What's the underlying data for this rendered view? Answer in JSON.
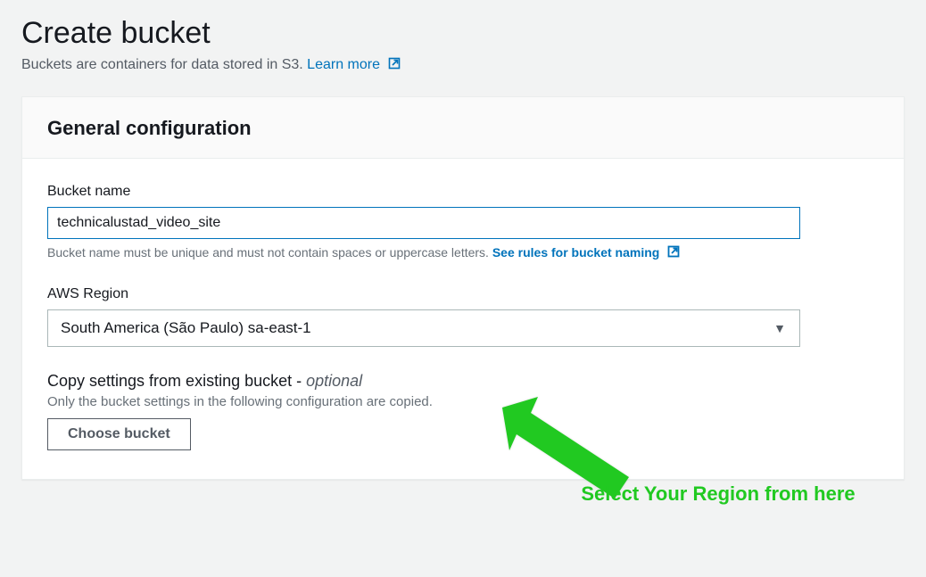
{
  "header": {
    "title": "Create bucket",
    "subtitle": "Buckets are containers for data stored in S3. ",
    "learn_more": "Learn more"
  },
  "panel": {
    "title": "General configuration"
  },
  "bucket_name": {
    "label": "Bucket name",
    "value": "technicalustad_video_site",
    "hint_text": "Bucket name must be unique and must not contain spaces or uppercase letters. ",
    "hint_link": "See rules for bucket naming"
  },
  "region": {
    "label": "AWS Region",
    "selected": "South America (São Paulo) sa-east-1"
  },
  "copy": {
    "heading_prefix": "Copy settings from existing bucket - ",
    "heading_optional": "optional",
    "sub": "Only the bucket settings in the following configuration are copied.",
    "button": "Choose bucket"
  },
  "annotation": {
    "text": "Select Your Region from here"
  }
}
